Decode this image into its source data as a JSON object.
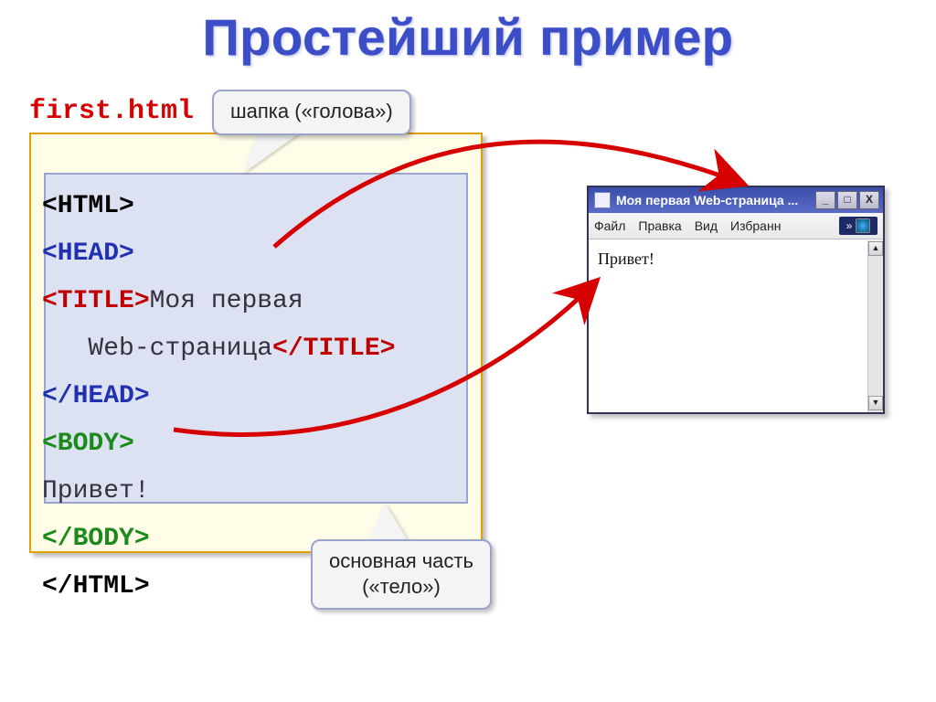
{
  "title": "Простейший пример",
  "filename": "first.html",
  "callouts": {
    "head": "шапка («голова»)",
    "body_line1": "основная часть",
    "body_line2": "(«тело»)"
  },
  "code": {
    "html_open": "<HTML>",
    "head_open": "<HEAD>",
    "title_open": "<TITLE>",
    "title_text_1": "Моя первая",
    "title_text_2": "   Web-страница",
    "title_close": "</TITLE>",
    "head_close": "</HEAD>",
    "body_open": "<BODY>",
    "body_text": "Привет!",
    "body_close": "</BODY>",
    "html_close": "</HTML>"
  },
  "browser": {
    "title": "Моя первая Web-страница ...",
    "menu": {
      "file": "Файл",
      "edit": "Правка",
      "view": "Вид",
      "fav": "Избранн",
      "chev": "»"
    },
    "controls": {
      "min": "_",
      "max": "□",
      "close": "X"
    },
    "scroll": {
      "up": "▲",
      "down": "▼"
    },
    "content": "Привет!"
  }
}
